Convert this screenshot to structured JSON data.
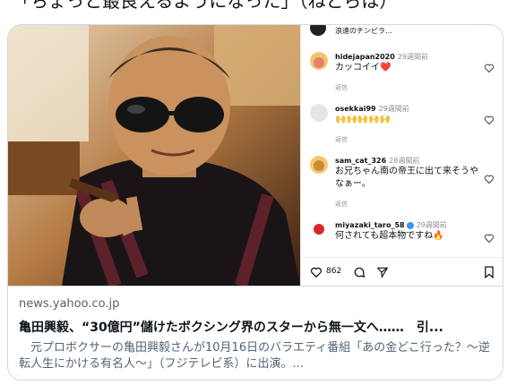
{
  "post_text": "「ちょっと最良えるようになった」（ねとらは）",
  "card": {
    "domain": "news.yahoo.co.jp",
    "headline": "亀田興毅、“30億円”儲けたボクシング界のスターから無一文へ……　引...",
    "description": "　元プロボクサーの亀田興毅さんが10月16日のバラエティ番組「あの金どこ行った？～逆転人生にかける有名人～」（フジテレビ系）に出演。..."
  },
  "instagram": {
    "top_partial": "浪速のチンピラ…",
    "comments": [
      {
        "user": "hidejapan2020",
        "time": "29週間前",
        "text": "カッコイイ❤️",
        "reply": "返信"
      },
      {
        "user": "osekkai99",
        "time": "29週間前",
        "text": "🙌🙌🙌🙌🙌",
        "reply": "返信"
      },
      {
        "user": "sam_cat_326",
        "time": "28週間前",
        "text": "お兄ちゃん南の帝王に出て来そうやなぁー。",
        "reply": "返信"
      },
      {
        "user": "miyazaki_taro_58",
        "time": "29週間前",
        "text": "何されても超本物ですね🔥",
        "reply": ""
      }
    ],
    "like_count": "862"
  },
  "colors": {
    "border": "#cfd9de",
    "muted": "#536471",
    "text": "#0f1419"
  }
}
